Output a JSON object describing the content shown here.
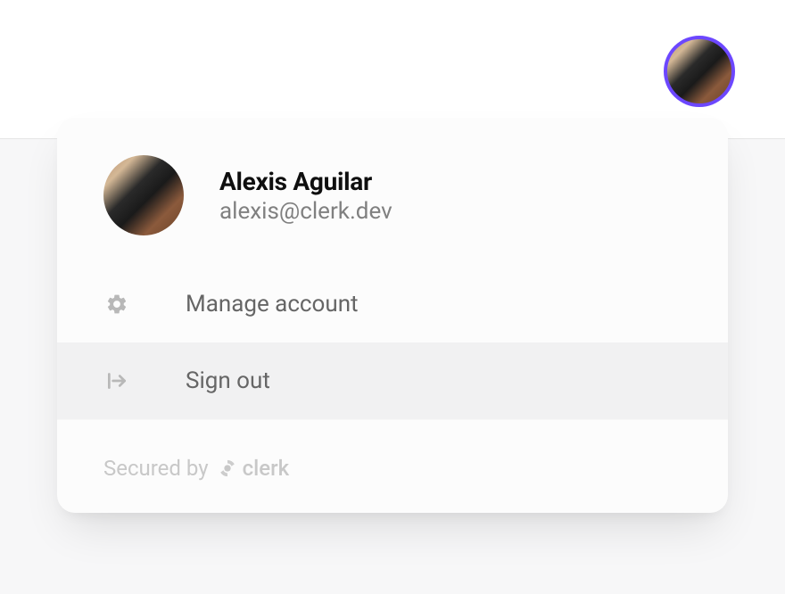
{
  "user": {
    "name": "Alexis Aguilar",
    "email": "alexis@clerk.dev"
  },
  "menu": {
    "manage_label": "Manage account",
    "signout_label": "Sign out"
  },
  "footer": {
    "secured_by": "Secured by",
    "brand": "clerk"
  },
  "colors": {
    "accent": "#6c47ff"
  }
}
